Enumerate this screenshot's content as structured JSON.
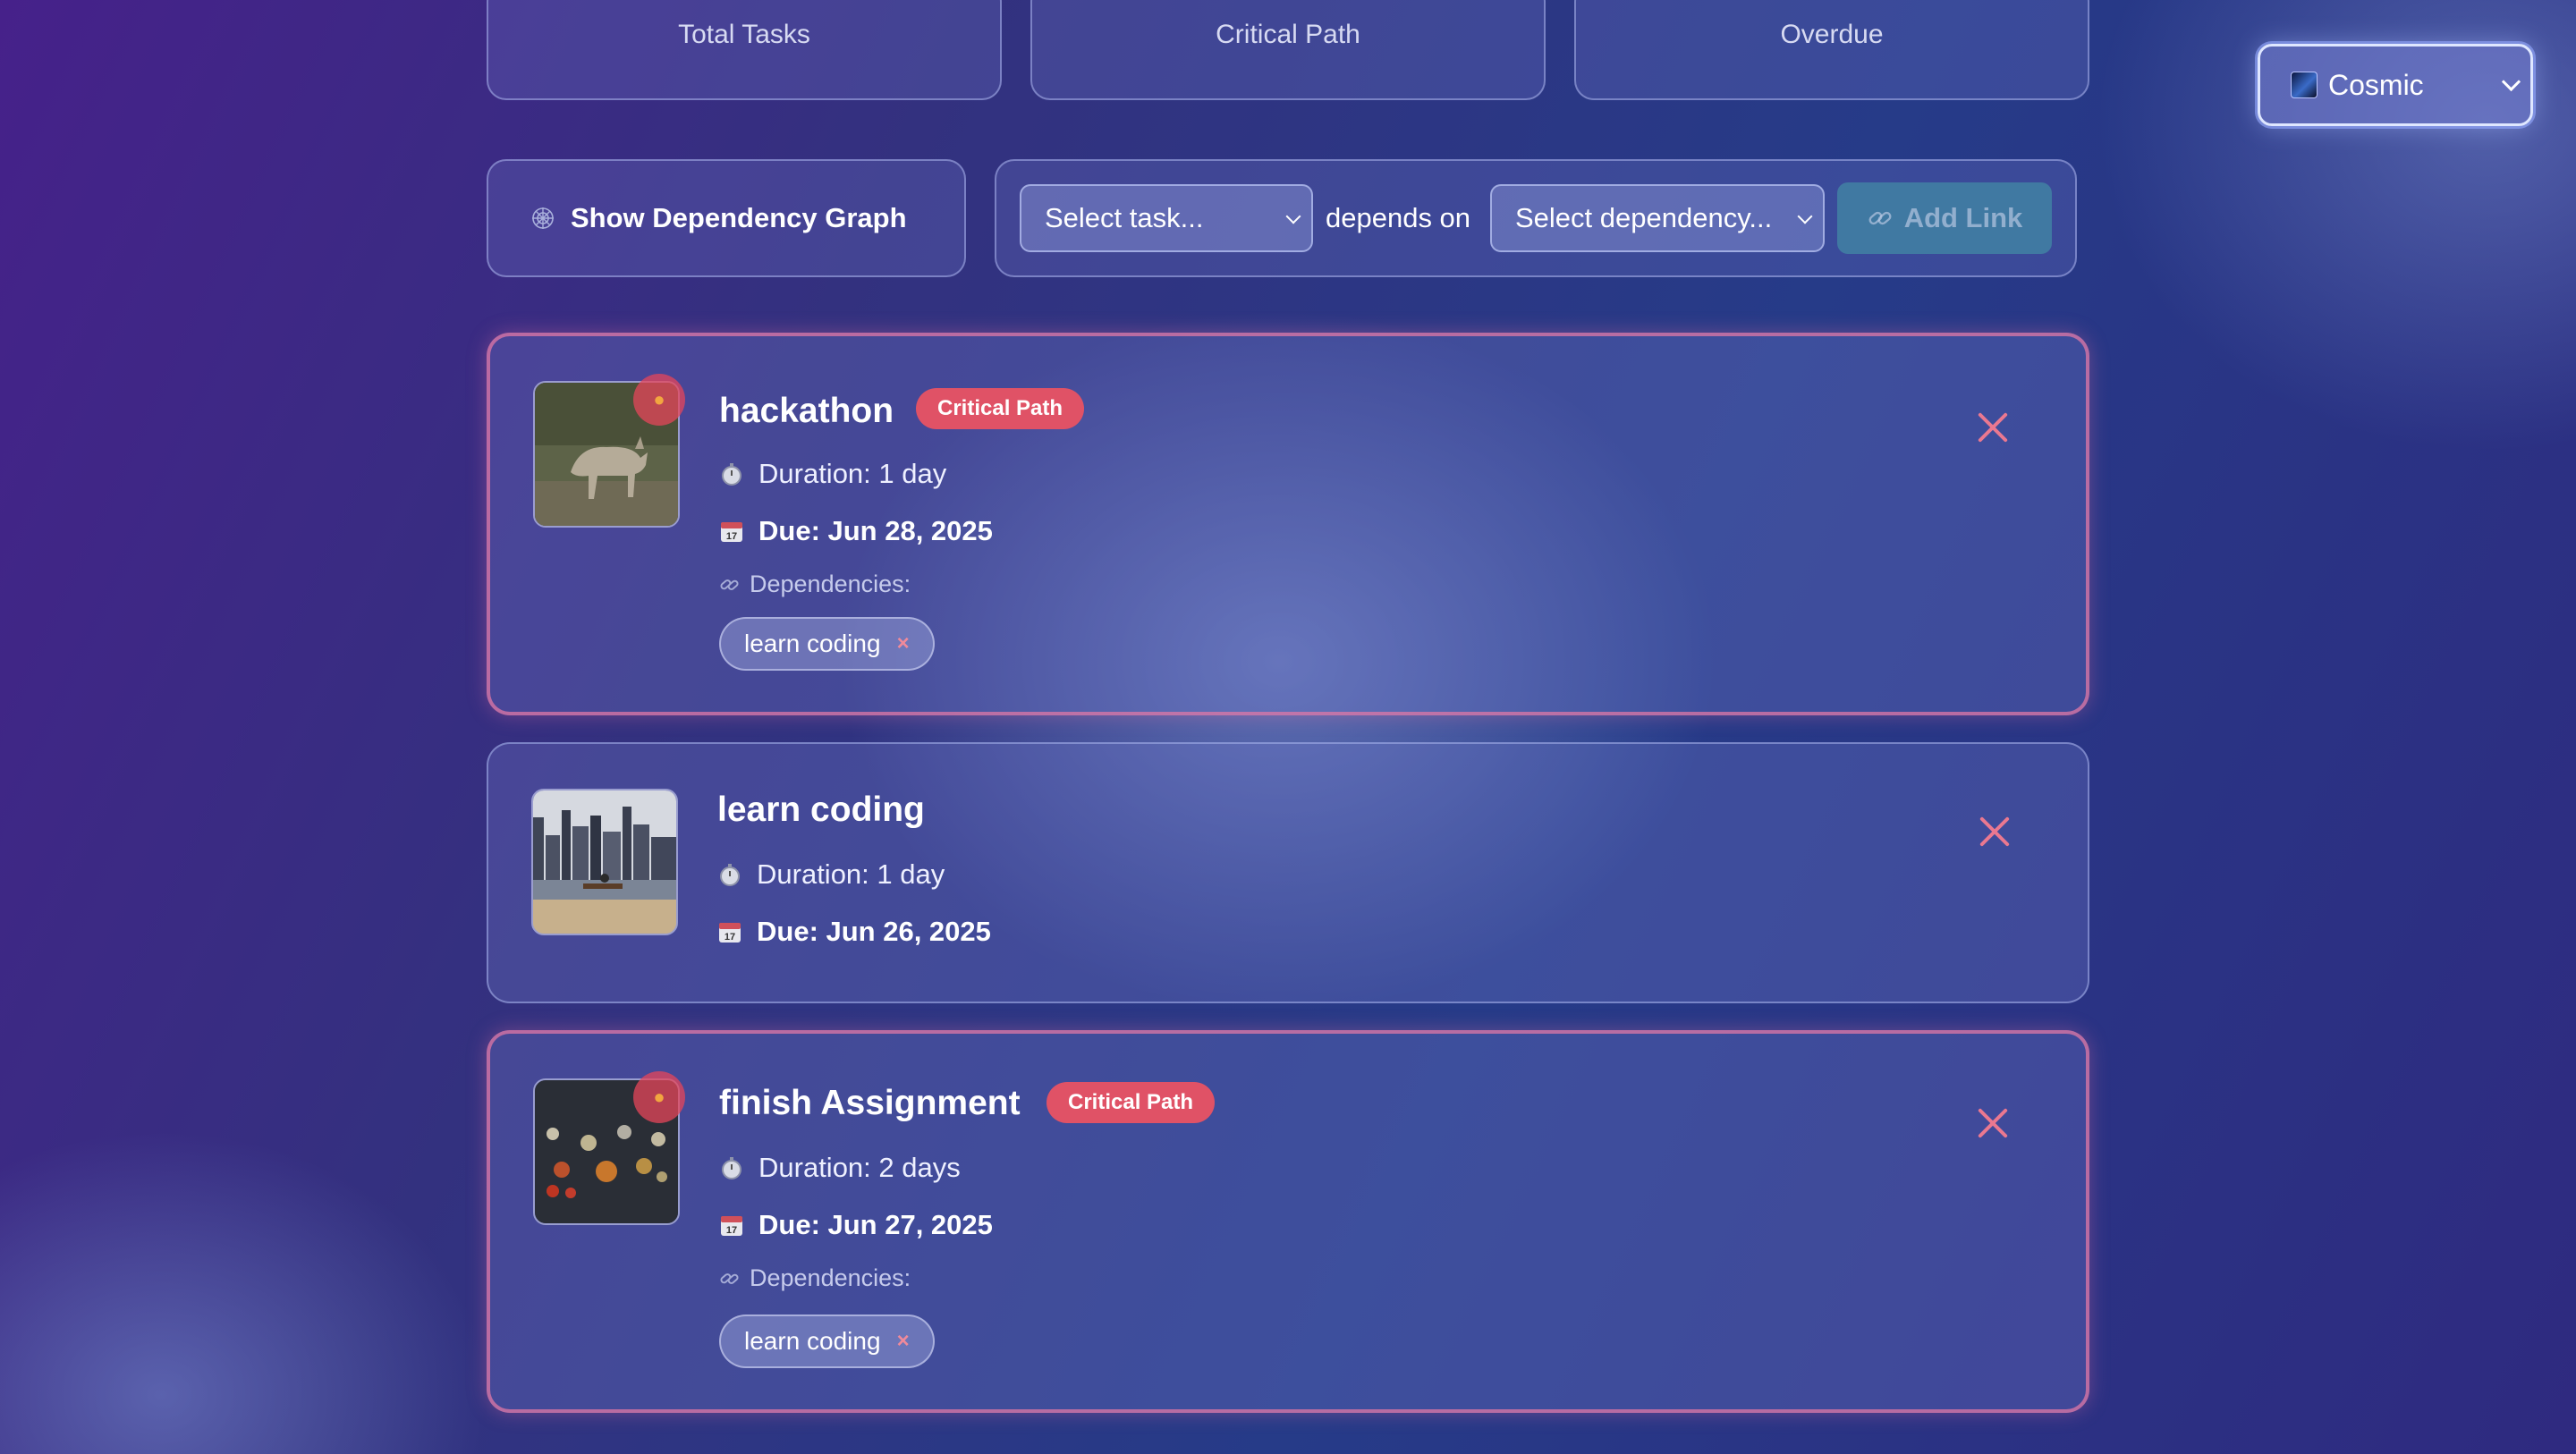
{
  "stats": [
    {
      "label": "Total Tasks"
    },
    {
      "label": "Critical Path"
    },
    {
      "label": "Overdue"
    }
  ],
  "theme": {
    "selected": "Cosmic",
    "icon": "cosmic-thumbnail-icon"
  },
  "toolbar": {
    "graph_button": "Show Dependency Graph",
    "task_select": "Select task...",
    "depends_on": "depends on",
    "dependency_select": "Select dependency...",
    "add_link": "Add Link"
  },
  "tasks": [
    {
      "title": "hackathon",
      "critical": true,
      "badge": "Critical Path",
      "duration": "Duration: 1 day",
      "due": "Due: Jun 28, 2025",
      "dependencies_label": "Dependencies:",
      "dependencies": [
        "learn coding"
      ],
      "image": "wolf-photo"
    },
    {
      "title": "learn coding",
      "critical": false,
      "duration": "Duration: 1 day",
      "due": "Due: Jun 26, 2025",
      "image": "city-skyline-photo"
    },
    {
      "title": "finish Assignment",
      "critical": true,
      "badge": "Critical Path",
      "duration": "Duration: 2 days",
      "due": "Due: Jun 27, 2025",
      "dependencies_label": "Dependencies:",
      "dependencies": [
        "learn coding"
      ],
      "image": "bokeh-lights-photo"
    }
  ],
  "colors": {
    "critical_badge": "#e05266",
    "close_icon": "#ea7890",
    "accent_link": "#46a0aa"
  }
}
